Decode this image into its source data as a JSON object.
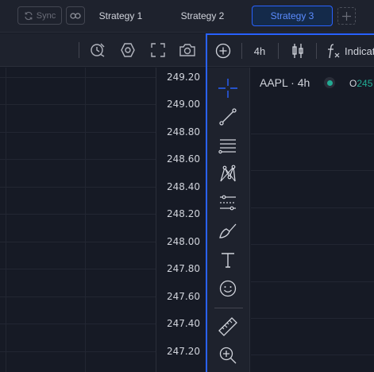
{
  "topbar": {
    "sync_label": "Sync",
    "tabs": [
      "Strategy 1",
      "Strategy 2",
      "Strategy 3"
    ],
    "active_tab": "Strategy 3"
  },
  "left_chart": {
    "toolbar_icons": [
      "alert-clock-icon",
      "hexagon-settings-icon",
      "fullscreen-icon",
      "camera-icon"
    ],
    "price_labels": [
      "249.20",
      "249.00",
      "248.80",
      "248.60",
      "248.40",
      "248.20",
      "248.00",
      "247.80",
      "247.60",
      "247.40",
      "247.20"
    ]
  },
  "right_pane": {
    "interval": "4h",
    "indicators_label": "Indicators",
    "symbol": "AAPL · 4h",
    "ohlc_key": "O",
    "ohlc_value": "245",
    "drawing_tools": [
      "crosshair-icon",
      "trend-line-icon",
      "fib-retracement-icon",
      "pattern-icon",
      "prediction-icon",
      "brush-icon",
      "text-icon",
      "emoji-icon",
      "ruler-icon",
      "zoom-in-icon"
    ]
  },
  "colors": {
    "accent": "#2962ff",
    "active_tab_text": "#5b8cff",
    "background": "#161a25",
    "panel": "#1e222d",
    "up_green": "#22ab94"
  }
}
